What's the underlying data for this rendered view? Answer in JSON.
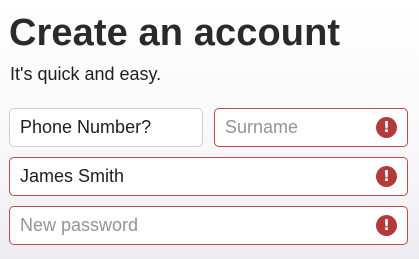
{
  "header": {
    "title": "Create an account",
    "subtitle": "It's quick and easy."
  },
  "form": {
    "phone": {
      "value": "Phone Number?",
      "error": false
    },
    "surname": {
      "placeholder": "Surname",
      "error": true,
      "icon": "error-icon"
    },
    "full_name": {
      "value": "James Smith",
      "error": true,
      "icon": "error-icon"
    },
    "password": {
      "placeholder": "New password",
      "error": true,
      "icon": "error-icon"
    },
    "error_icon_glyph": "!"
  },
  "colors": {
    "error": "#be4b49",
    "error_icon": "#b33a3a",
    "text": "#1c1e21",
    "placeholder": "#90949c",
    "border": "#ccd0d5"
  }
}
